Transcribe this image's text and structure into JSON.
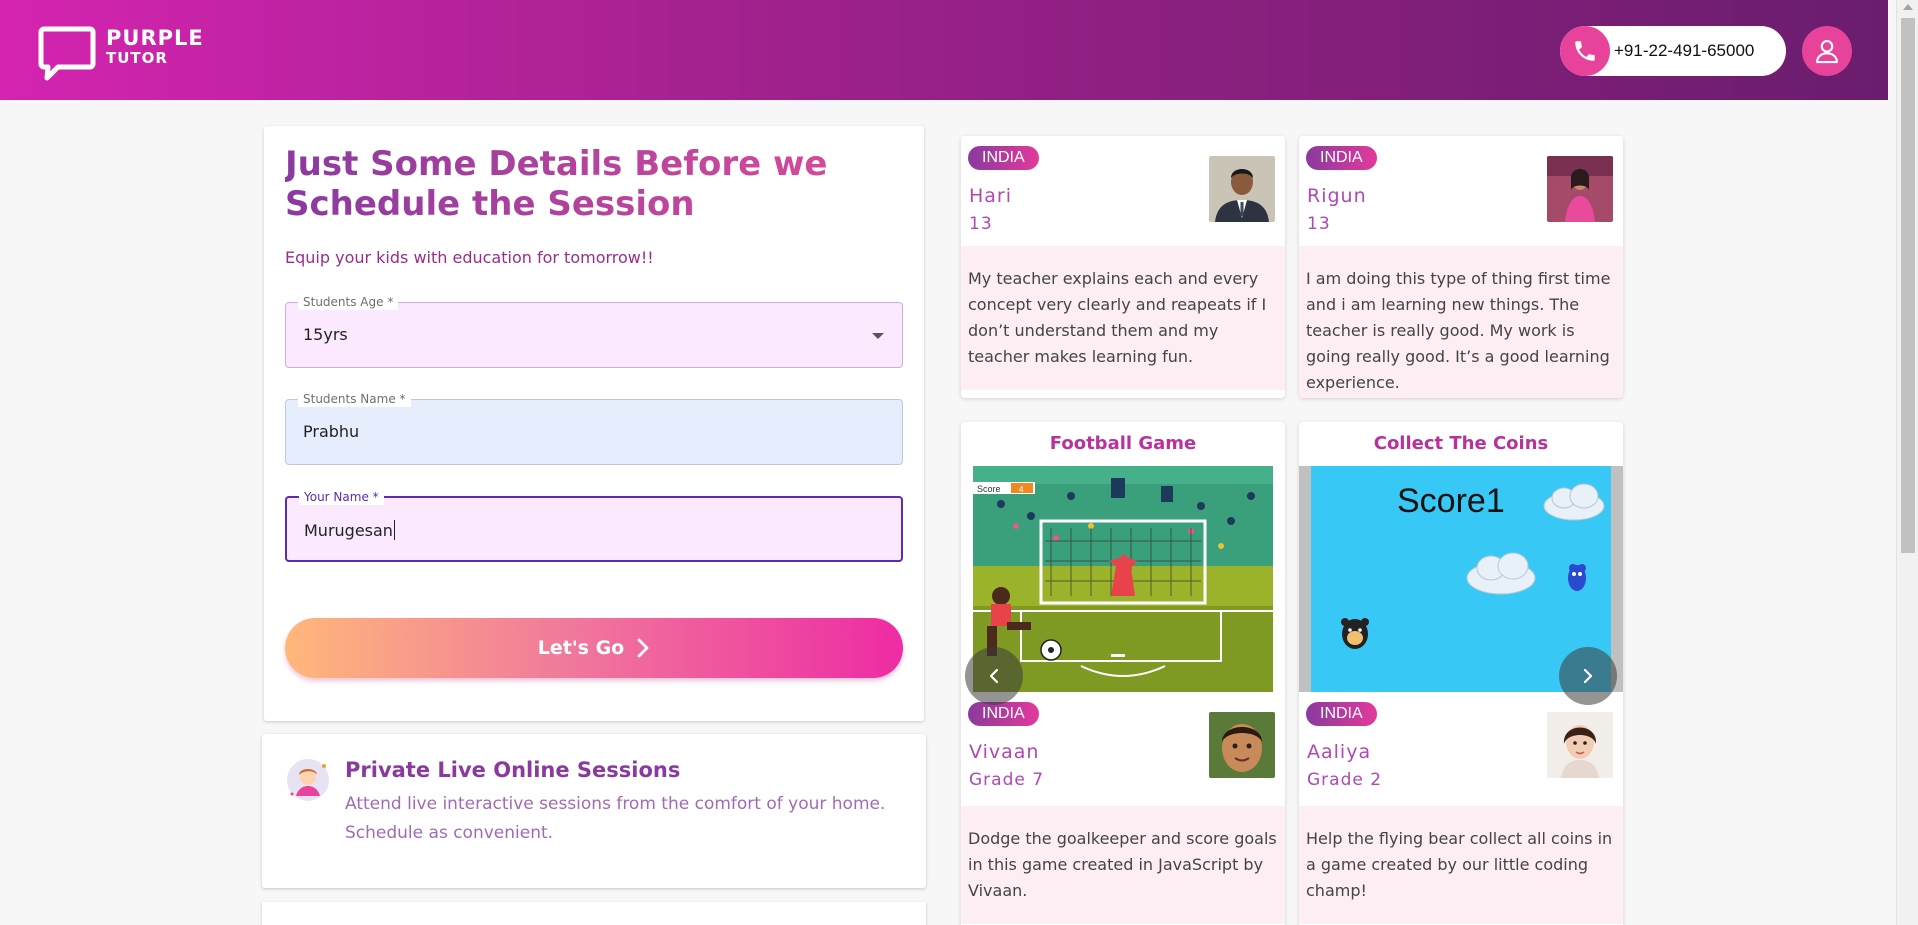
{
  "header": {
    "logo_line1": "PURPLE",
    "logo_line2": "TUTOR",
    "phone": "+91-22-491-65000"
  },
  "form": {
    "title": "Just Some Details Before we Schedule the Session",
    "subtitle": "Equip your kids with education for tomorrow!!",
    "age_label": "Students Age *",
    "age_value": "15yrs",
    "student_label": "Students Name *",
    "student_value": "Prabhu",
    "your_label": "Your Name *",
    "your_value": "Murugesan",
    "submit_label": "Let's Go"
  },
  "info": {
    "title": "Private Live Online Sessions",
    "text": "Attend live interactive sessions from the comfort of your home. Schedule as convenient."
  },
  "testimonials": [
    {
      "country": "INDIA",
      "name": "Hari",
      "age": "13",
      "text": "My teacher explains each and every concept very clearly and reapeats if I don’t understand them and my teacher makes learning fun."
    },
    {
      "country": "INDIA",
      "name": "Rigun",
      "age": "13",
      "text": "I am doing this type of thing first time and i am learning new things. The teacher is really good. My work is going really good. It’s a good learning experience."
    }
  ],
  "games": [
    {
      "title": "Football Game",
      "country": "INDIA",
      "name": "Vivaan",
      "grade": "Grade 7",
      "score_label": "Score",
      "score_value": "4",
      "text": "Dodge the goalkeeper and score goals in this game created in JavaScript by Vivaan."
    },
    {
      "title": "Collect The Coins",
      "country": "INDIA",
      "name": "Aaliya",
      "grade": "Grade 2",
      "score_label": "Score1",
      "text": "Help the flying bear collect all coins in a game created by our little coding champ!"
    }
  ],
  "colors": {
    "brand_pink": "#e8439b",
    "brand_purple": "#8a3a9f",
    "header_start": "#d424b0",
    "header_end": "#6a1d6d"
  },
  "icons": [
    "chat-bubble-logo-icon",
    "phone-icon",
    "user-icon",
    "dropdown-arrow-icon",
    "chevron-right-icon",
    "chevron-left-icon",
    "tutor-avatar-icon"
  ]
}
